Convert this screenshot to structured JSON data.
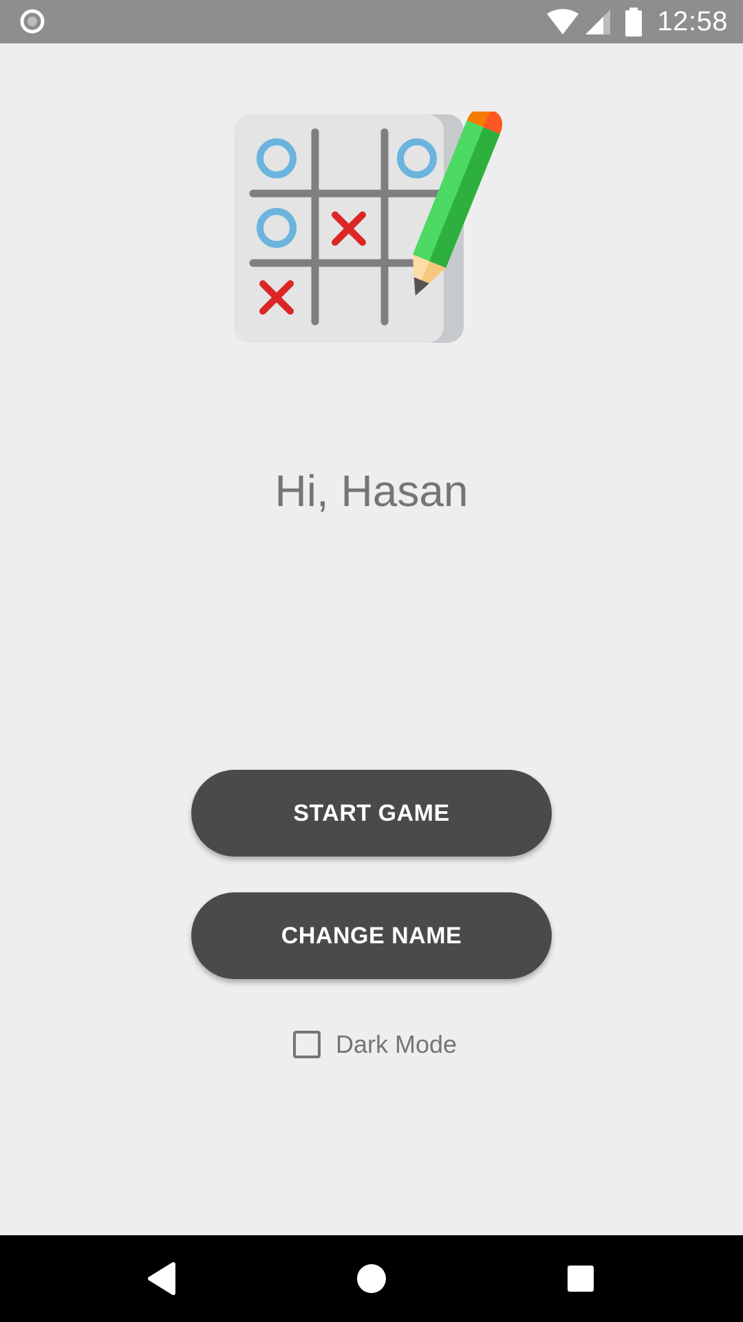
{
  "status_bar": {
    "time": "12:58",
    "background_color": "#8E8E8E",
    "icons": [
      "notification-dot-icon",
      "wifi-icon",
      "cellular-signal-icon",
      "battery-icon"
    ]
  },
  "logo": {
    "icon": "tic-tac-toe-pencil-icon",
    "marks": {
      "o_color": "#6AB4DE",
      "x_color": "#DC2626",
      "pencil_color": "#4CD964"
    }
  },
  "greeting": {
    "text": "Hi, Hasan",
    "color": "#757575"
  },
  "buttons": {
    "start_game": "START GAME",
    "change_name": "CHANGE NAME",
    "background_color": "#4A4A4A"
  },
  "dark_mode": {
    "label": "Dark Mode",
    "checked": false
  },
  "nav_bar": {
    "icons": [
      "back-icon",
      "home-icon",
      "recents-icon"
    ]
  }
}
